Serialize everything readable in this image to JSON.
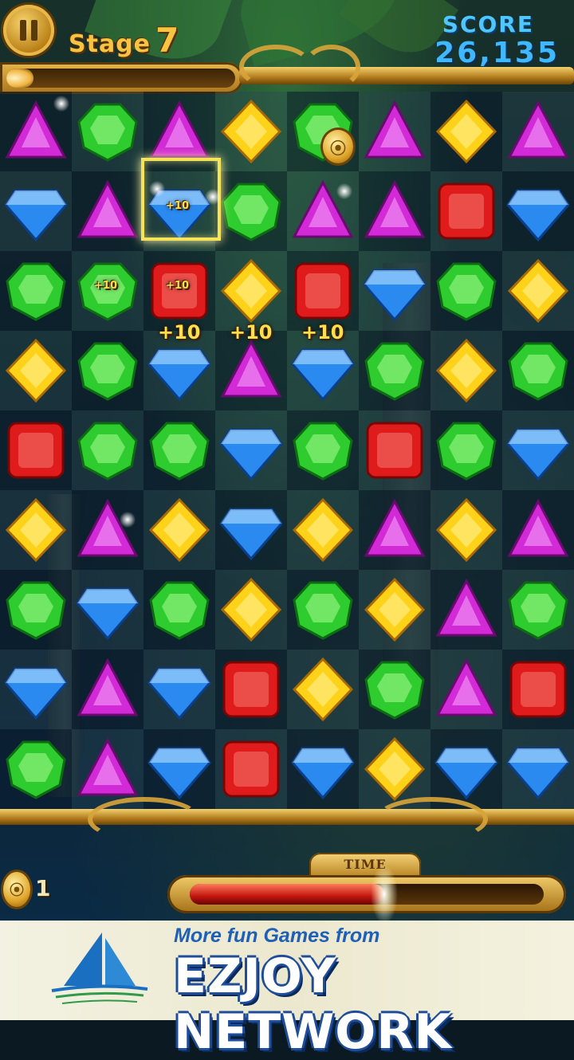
{
  "hud": {
    "stage_label": "Stage",
    "stage_number": "7",
    "score_label": "SCORE",
    "score_value": "26,135",
    "level_progress": 0.12
  },
  "timer": {
    "label": "TIME",
    "remaining_fraction": 0.55
  },
  "coins": {
    "count": "1"
  },
  "board": {
    "cols": 8,
    "rows": 9,
    "gems": [
      [
        "purple",
        "green",
        "purple",
        "yellow",
        "green",
        "purple",
        "yellow",
        "purple"
      ],
      [
        "blue",
        "purple",
        "blue",
        "green",
        "purple",
        "purple",
        "red",
        "blue"
      ],
      [
        "green",
        "green",
        "red",
        "yellow",
        "red",
        "blue",
        "green",
        "yellow"
      ],
      [
        "yellow",
        "green",
        "blue",
        "purple",
        "blue",
        "green",
        "yellow",
        "green"
      ],
      [
        "red",
        "green",
        "green",
        "blue",
        "green",
        "red",
        "green",
        "blue"
      ],
      [
        "yellow",
        "purple",
        "yellow",
        "blue",
        "yellow",
        "purple",
        "yellow",
        "purple"
      ],
      [
        "green",
        "blue",
        "green",
        "yellow",
        "green",
        "yellow",
        "purple",
        "green"
      ],
      [
        "blue",
        "purple",
        "blue",
        "red",
        "yellow",
        "green",
        "purple",
        "red"
      ],
      [
        "green",
        "purple",
        "blue",
        "red",
        "blue",
        "yellow",
        "blue",
        "blue"
      ]
    ],
    "selected": {
      "row": 2,
      "col": 2
    },
    "popups": [
      {
        "text": "+10",
        "size": "small",
        "cell": [
          1,
          2
        ]
      },
      {
        "text": "+10",
        "size": "small",
        "cell": [
          2,
          1
        ]
      },
      {
        "text": "+10",
        "size": "small",
        "cell": [
          2,
          2
        ]
      },
      {
        "text": "+10",
        "size": "big",
        "cell": [
          3,
          2
        ]
      },
      {
        "text": "+10",
        "size": "big",
        "cell": [
          3,
          3
        ]
      },
      {
        "text": "+10",
        "size": "big",
        "cell": [
          3,
          4
        ]
      }
    ]
  },
  "gem_colors": {
    "green": "#2ecc2e",
    "blue": "#2b8af0",
    "purple": "#d12ad6",
    "yellow": "#ffd21a",
    "red": "#e01b1b"
  },
  "ad": {
    "tagline": "More fun Games from",
    "brand": "EZJOY NETWORK"
  }
}
